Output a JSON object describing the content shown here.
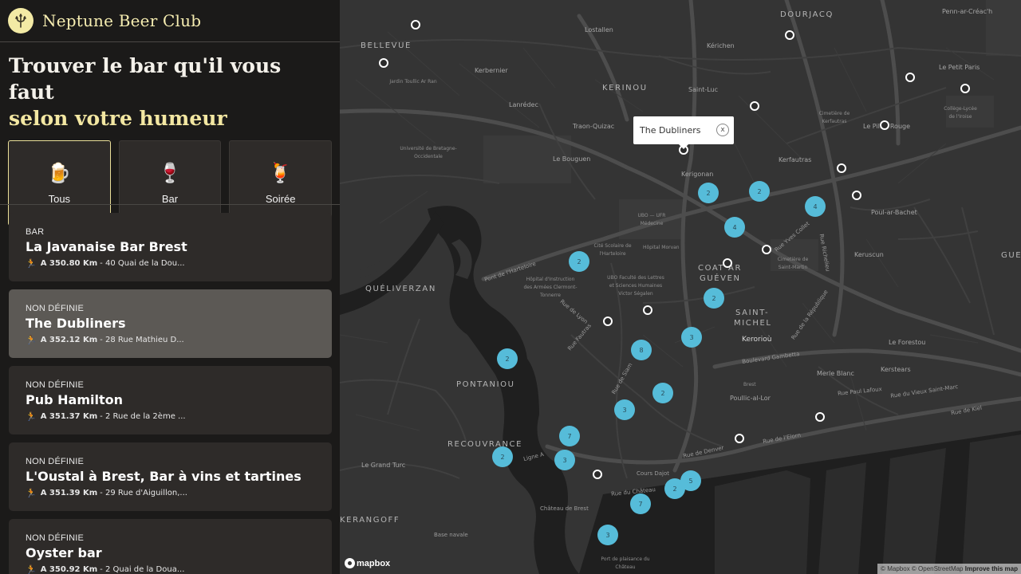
{
  "brand": {
    "name": "Neptune Beer Club",
    "logo_icon": "trident-icon"
  },
  "heading": {
    "line1": "Trouver le bar qu'il vous faut",
    "line2": "selon votre humeur"
  },
  "filters": [
    {
      "emoji": "🍺",
      "icon": "beer-mug-icon",
      "label": "Tous",
      "active": true
    },
    {
      "emoji": "🍷",
      "icon": "wine-glass-icon",
      "label": "Bar",
      "active": false
    },
    {
      "emoji": "🍹",
      "icon": "tropical-drink-icon",
      "label": "Soirée",
      "active": false
    }
  ],
  "bars": [
    {
      "category": "BAR",
      "name": "La Javanaise Bar Brest",
      "distance": "A 350.80 Km",
      "address": "- 40 Quai de la Dou..."
    },
    {
      "category": "NON DÉFINIE",
      "name": "The Dubliners",
      "distance": "A 352.12 Km",
      "address": "- 28 Rue Mathieu D..."
    },
    {
      "category": "NON DÉFINIE",
      "name": "Pub Hamilton",
      "distance": "A 351.37 Km",
      "address": "- 2 Rue de la 2ème ..."
    },
    {
      "category": "NON DÉFINIE",
      "name": "L'Oustal à Brest, Bar à vins et tartines",
      "distance": "A 351.39 Km",
      "address": "- 29 Rue d'Aiguillon,..."
    },
    {
      "category": "NON DÉFINIE",
      "name": "Oyster bar",
      "distance": "A 350.92 Km",
      "address": "- 2 Quai de la Doua..."
    }
  ],
  "map": {
    "popup": {
      "title": "The Dubliners",
      "close": "x"
    },
    "clusters": [
      "2",
      "2",
      "4",
      "4",
      "2",
      "2",
      "3",
      "8",
      "2",
      "2",
      "3",
      "7",
      "2",
      "3",
      "5",
      "2",
      "7",
      "3"
    ],
    "districts": [
      "BELLEVUE",
      "KERINOU",
      "DOURJACQ",
      "QUÉLIVERZAN",
      "COAT AR",
      "GUÉVEN",
      "SAINT-",
      "MICHEL",
      "PONTANIOU",
      "RECOUVRANCE",
      "KERANGOFF",
      "GUE"
    ],
    "places": [
      "Lostallen",
      "Kérichen",
      "Kerbernier",
      "Saint-Luc",
      "Penn-ar-Créac'h",
      "Le Petit Paris",
      "Lanrédec",
      "Traon-Quizac",
      "Le Bouguen",
      "Le Pilier Rouge",
      "Kerfautras",
      "Kerigonan",
      "Poul-ar-Bachet",
      "Keruscun",
      "Kerorioù",
      "Le Forestou",
      "Merle Blanc",
      "Kerstears",
      "Poullic-al-Lor",
      "Le Grand Turc",
      "Cours Dajot",
      "Château de Brest",
      "Base navale",
      "Port de plaisance du Château",
      "Hôpital Morvan",
      "Cité Scolaire de l'Harteloire",
      "Hôpital d'Instruction des Armées Clermont-Tonnerre",
      "UBO Faculté des Lettres et Sciences Humaines Victor Ségalen",
      "Université de Bretagne-Occidentale",
      "Cimetière de Saint-Martin",
      "Cimetière de Kerfautras",
      "Jardin Toullic Ar Ran",
      "UBO — UFR Médecine",
      "Collège-Lycée de l'Iroise",
      "Brest"
    ],
    "streets": [
      "Pont de l'Harteloire",
      "Rue de Lyon",
      "Rue Fautras",
      "Boulevard Gambetta",
      "Rue de la République",
      "Rue Yves Collet",
      "Rue Richelieu",
      "Ligne A",
      "Rue de Siam",
      "Rue de l'Elorn",
      "Rue de Denver",
      "Rue du Vieux Saint-Marc",
      "Rue de Kiel",
      "Rue Paul Lafoux",
      "Rue du Château"
    ],
    "logo_text": "mapbox",
    "attribution": "© Mapbox © OpenStreetMap",
    "improve_link": "Improve this map"
  }
}
